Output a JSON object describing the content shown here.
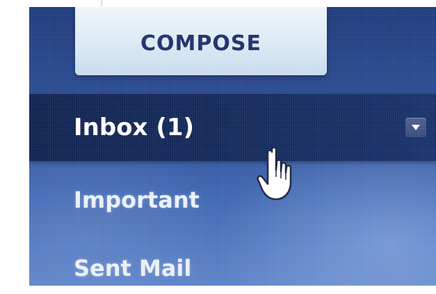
{
  "compose": {
    "label": "COMPOSE"
  },
  "nav": {
    "items": [
      {
        "label": "Inbox (1)",
        "active": true
      },
      {
        "label": "Important",
        "active": false
      },
      {
        "label": "Sent Mail",
        "active": false
      }
    ]
  },
  "icons": {
    "dropdown": "chevron-down-icon",
    "cursor": "hand-cursor-icon"
  },
  "colors": {
    "background": "#2a4c94",
    "active_row": "#142a5c",
    "compose_bg": "#dbe9f4",
    "compose_text": "#1e2f6a",
    "nav_text": "#ffffff"
  }
}
